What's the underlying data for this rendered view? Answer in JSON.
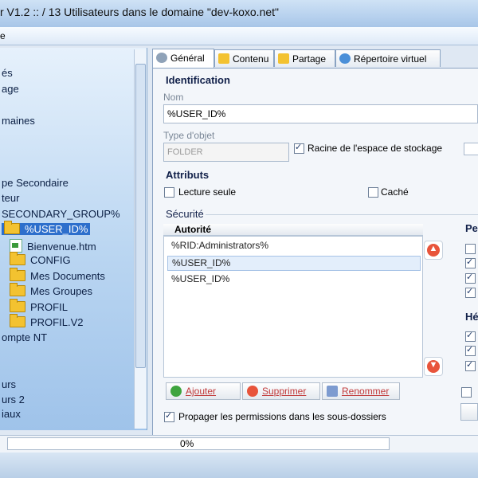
{
  "window": {
    "title": "r V1.2 :: / 13 Utilisateurs dans le domaine \"dev-koxo.net\"",
    "menu_edge": "e"
  },
  "tree": {
    "items": [
      {
        "label": "és"
      },
      {
        "label": "age"
      },
      {
        "label": "maines"
      },
      {
        "label": "pe Secondaire"
      },
      {
        "label": "teur"
      },
      {
        "label": "SECONDARY_GROUP%"
      },
      {
        "label": "%USER_ID%",
        "selected": true
      },
      {
        "label": "Bienvenue.htm",
        "icon": "html-file-icon"
      },
      {
        "label": "CONFIG",
        "icon": "folder-icon"
      },
      {
        "label": "Mes Documents",
        "icon": "folder-icon"
      },
      {
        "label": "Mes Groupes",
        "icon": "folder-icon"
      },
      {
        "label": "PROFIL",
        "icon": "folder-icon"
      },
      {
        "label": "PROFIL.V2",
        "icon": "folder-icon"
      },
      {
        "label": "ompte NT"
      },
      {
        "label": "urs"
      },
      {
        "label": "urs 2"
      },
      {
        "label": "iaux"
      }
    ]
  },
  "tabs": [
    {
      "label": "Général",
      "active": true
    },
    {
      "label": "Contenu"
    },
    {
      "label": "Partage"
    },
    {
      "label": "Répertoire virtuel"
    }
  ],
  "identification": {
    "section": "Identification",
    "name_label": "Nom",
    "name_value": "%USER_ID%",
    "type_label": "Type d'objet",
    "type_value": "FOLDER",
    "storage_root_label": "Racine de l'espace de stockage",
    "storage_root_checked": true
  },
  "attributes": {
    "section": "Attributs",
    "readonly_label": "Lecture seule",
    "readonly_checked": false,
    "hidden_label": "Caché",
    "hidden_checked": false
  },
  "security": {
    "section": "Sécurité",
    "authority_header": "Autorité",
    "authorities": [
      "%RID:Administrators%",
      "%USER_ID%",
      "%USER_ID%"
    ],
    "selected_index": 1,
    "perm_header_partial": "Pe",
    "herit_header_partial": "Hé",
    "buttons": {
      "add": "Ajouter",
      "delete": "Supprimer",
      "rename": "Renommer"
    },
    "propagate_label": "Propager les permissions dans les sous-dossiers",
    "propagate_checked": true
  },
  "status": {
    "progress_text": "0%"
  },
  "colors": {
    "accent": "#2d6fcc",
    "danger": "#e8543b",
    "success": "#3ea43e"
  }
}
